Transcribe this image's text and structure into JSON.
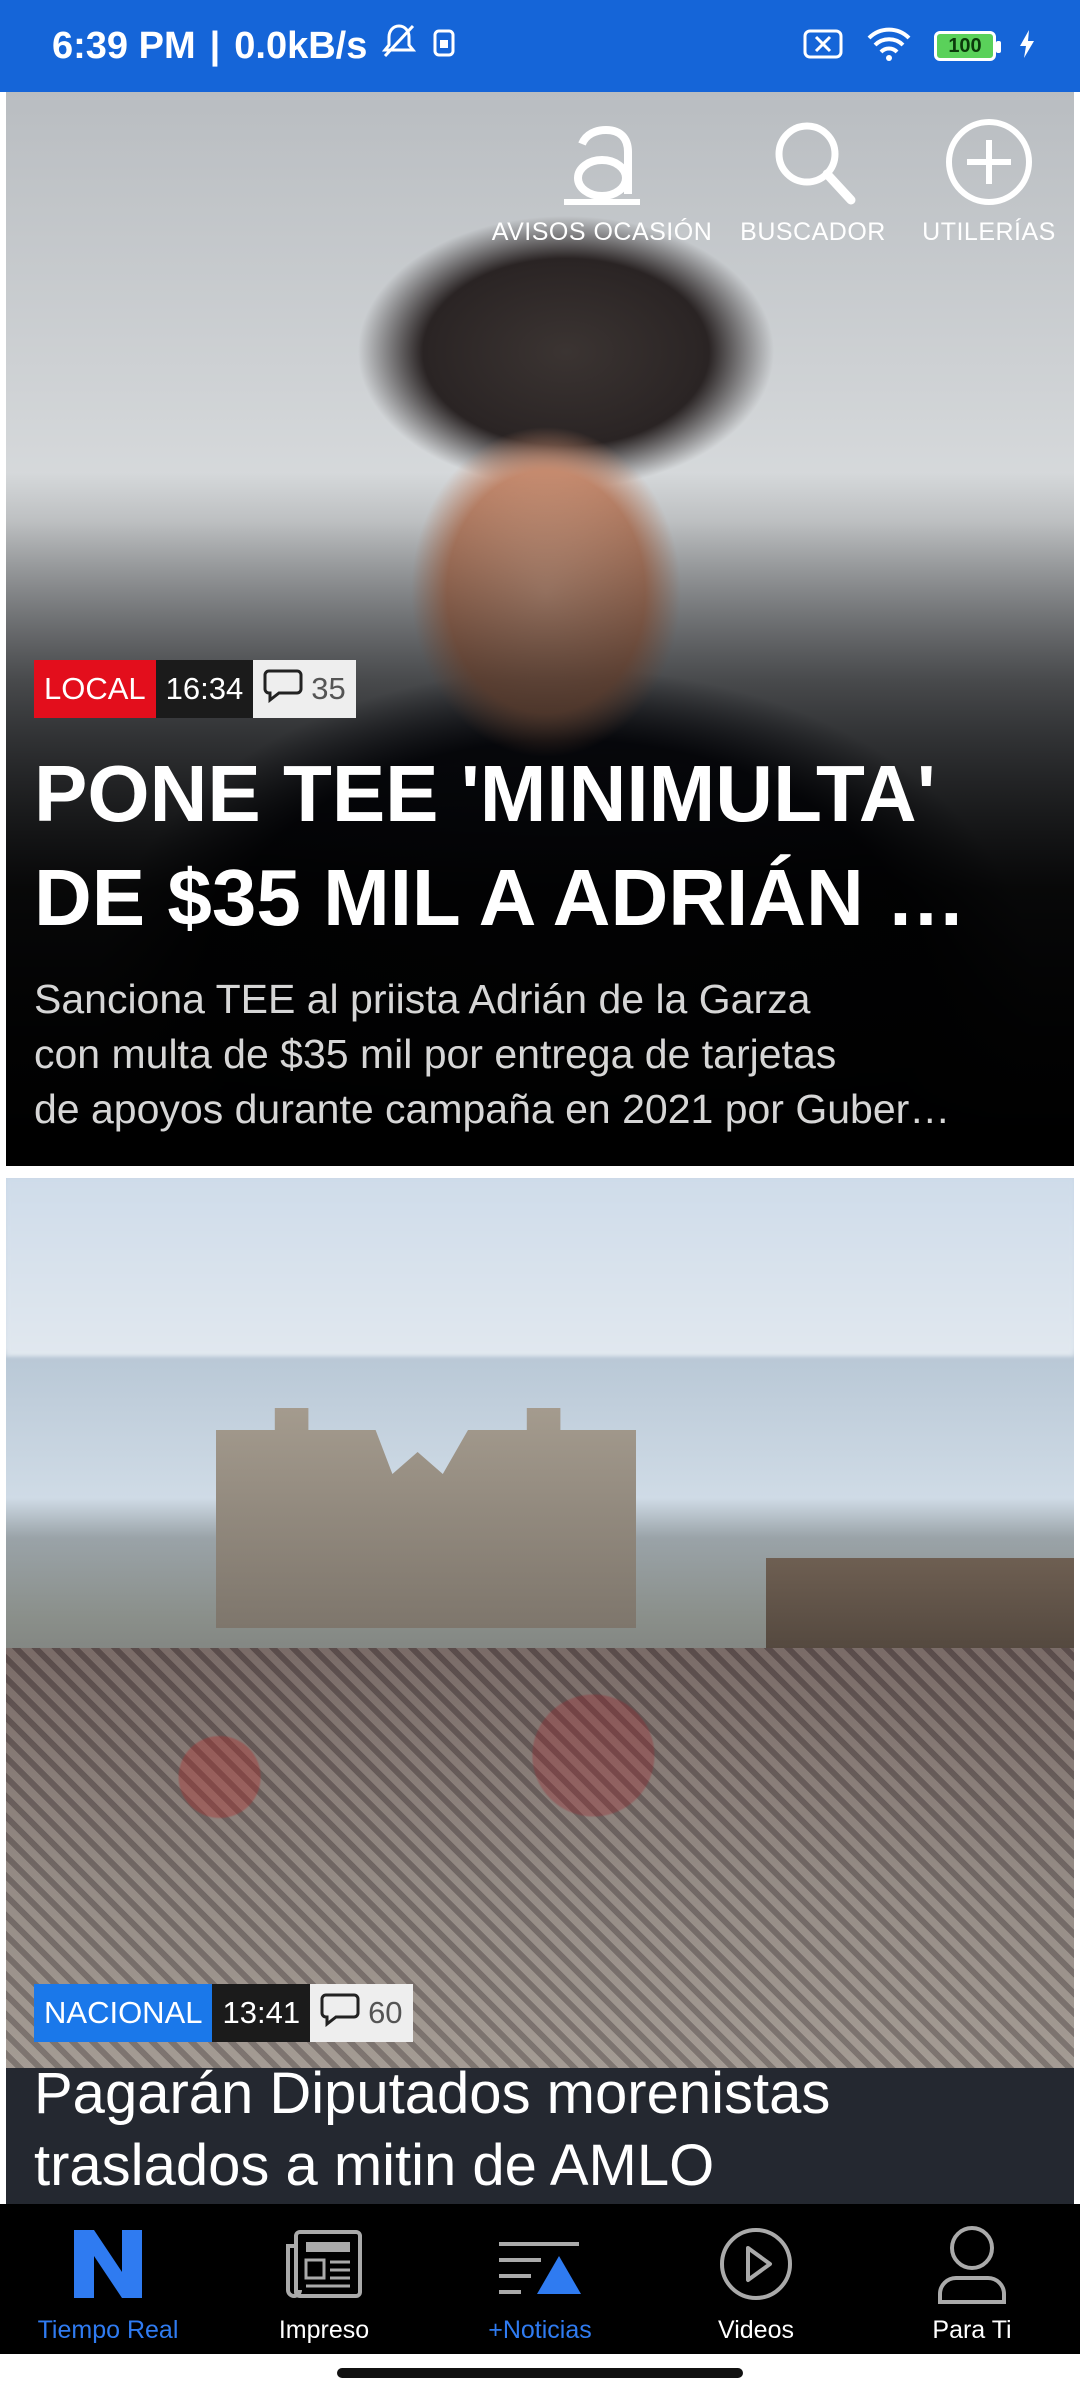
{
  "status_bar": {
    "time": "6:39 PM",
    "separator": "|",
    "speed": "0.0kB/s",
    "battery": "100"
  },
  "top_nav": {
    "items": [
      {
        "label": "AVISOS OCASIÓN",
        "icon": "avisos-a-icon"
      },
      {
        "label": "BUSCADOR",
        "icon": "search-icon"
      },
      {
        "label": "UTILERÍAS",
        "icon": "plus-circle-icon"
      }
    ]
  },
  "articles": [
    {
      "category": "LOCAL",
      "time": "16:34",
      "comments": "35",
      "headline_line1": "PONE TEE 'MINIMULTA'",
      "headline_line2": "DE $35 MIL A ADRIÁN …",
      "summary_line1": "Sanciona TEE al priista Adrián de la Garza",
      "summary_line2": "con multa de $35 mil por entrega de tarjetas",
      "summary_line3": "de apoyos durante campaña en 2021 por Guber…",
      "category_color": "#e30e1c"
    },
    {
      "category": "NACIONAL",
      "time": "13:41",
      "comments": "60",
      "headline_line1": "Pagarán Diputados morenistas",
      "headline_line2": "traslados a mitin de AMLO",
      "category_color": "#1a78ea"
    }
  ],
  "bottom_nav": {
    "items": [
      {
        "label": "Tiempo Real",
        "icon": "tiempo-real-n-icon",
        "active": true
      },
      {
        "label": "Impreso",
        "icon": "newspaper-icon",
        "active": false
      },
      {
        "label": "+Noticias",
        "icon": "more-news-icon",
        "active": false
      },
      {
        "label": "Videos",
        "icon": "play-icon",
        "active": false
      },
      {
        "label": "Para Ti",
        "icon": "user-icon",
        "active": false
      }
    ]
  },
  "colors": {
    "status_bar": "#1565d8",
    "accent": "#2f7bf1"
  }
}
